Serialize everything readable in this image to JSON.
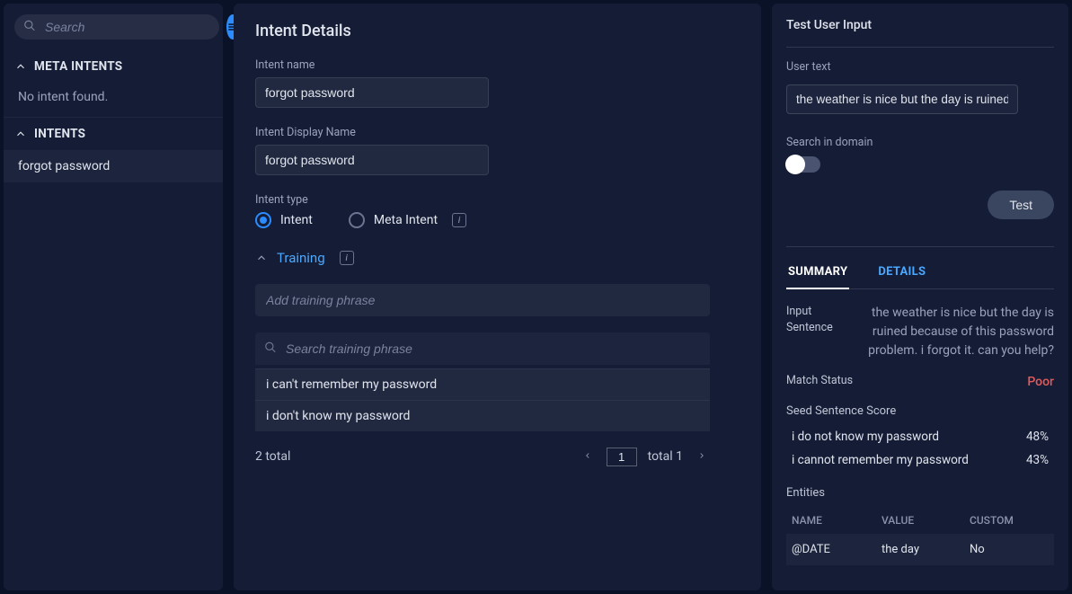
{
  "sidebar": {
    "search_placeholder": "Search",
    "meta_intents": {
      "title": "META INTENTS",
      "empty": "No intent found."
    },
    "intents": {
      "title": "INTENTS",
      "items": [
        "forgot password"
      ]
    }
  },
  "main": {
    "title": "Intent Details",
    "intent_name_label": "Intent name",
    "intent_name_value": "forgot password",
    "intent_display_label": "Intent Display Name",
    "intent_display_value": "forgot password",
    "intent_type_label": "Intent type",
    "radio_intent": "Intent",
    "radio_meta": "Meta Intent",
    "training_label": "Training",
    "add_phrase_placeholder": "Add training phrase",
    "search_phrase_placeholder": "Search training phrase",
    "phrases": [
      "i can't remember my password",
      "i don't know my password"
    ],
    "pagination": {
      "total_label": "2 total",
      "page": "1",
      "total_pages": "total 1"
    }
  },
  "right": {
    "title": "Test User Input",
    "user_text_label": "User text",
    "user_text_value": "the weather is nice but the day is ruined bec",
    "search_domain_label": "Search in domain",
    "test_button": "Test",
    "tabs": {
      "summary": "SUMMARY",
      "details": "DETAILS"
    },
    "input_sentence_label": "Input Sentence",
    "input_sentence_value": "the weather is nice but the day is ruined because of this password problem. i forgot it. can you help?",
    "match_status_label": "Match Status",
    "match_status_value": "Poor",
    "seed_label": "Seed Sentence Score",
    "seeds": [
      {
        "text": "i do not know my password",
        "score": "48%"
      },
      {
        "text": "i cannot remember my password",
        "score": "43%"
      }
    ],
    "entities_label": "Entities",
    "entities_headers": {
      "name": "NAME",
      "value": "VALUE",
      "custom": "CUSTOM"
    },
    "entities_rows": [
      {
        "name": "@DATE",
        "value": "the day",
        "custom": "No"
      }
    ]
  }
}
